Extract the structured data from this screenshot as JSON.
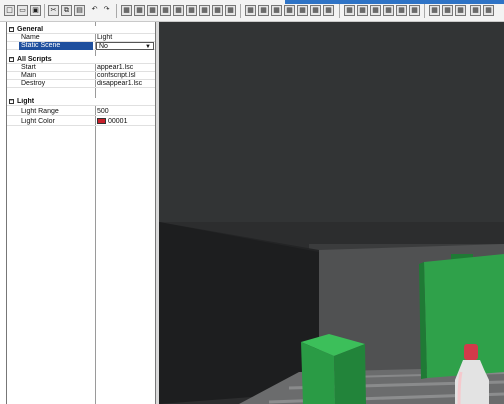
{
  "toolbar": {
    "icons": [
      "new-file-icon",
      "open-folder-icon",
      "save-icon",
      "cut-icon",
      "copy-icon",
      "paste-icon",
      "undo-icon",
      "redo-icon"
    ],
    "tool_icons": [
      "grid-tool-icon",
      "grid-tool-icon",
      "grid-tool-icon",
      "grid-tool-icon",
      "grid-tool-icon",
      "grid-tool-icon",
      "grid-tool-icon",
      "grid-tool-icon",
      "grid-tool-icon",
      "grid-tool-icon",
      "grid-tool-icon",
      "grid-tool-icon",
      "grid-tool-icon",
      "grid-tool-icon",
      "grid-tool-icon",
      "grid-tool-icon",
      "grid-tool-icon",
      "grid-tool-icon",
      "grid-tool-icon",
      "grid-tool-icon",
      "grid-tool-icon",
      "grid-tool-icon",
      "grid-tool-icon",
      "grid-tool-icon",
      "grid-tool-icon"
    ],
    "accent_color": "#2e73c6"
  },
  "properties": {
    "general": {
      "title": "General",
      "rows": [
        {
          "key": "Name",
          "value": "Light"
        },
        {
          "key": "Static Scene",
          "value": "No"
        }
      ]
    },
    "scripts": {
      "title": "All Scripts",
      "rows": [
        {
          "key": "Start",
          "value": "appear1.lsc"
        },
        {
          "key": "Main",
          "value": "confscript.lsl"
        },
        {
          "key": "Destroy",
          "value": "disappear1.lsc"
        }
      ]
    },
    "light": {
      "title": "Light",
      "rows": [
        {
          "key": "Light Range",
          "value": "500"
        },
        {
          "key": "Light Color",
          "value": "00001"
        }
      ],
      "color_swatch": "#c8202a"
    }
  },
  "viewport": {
    "background": "#2c2d2e",
    "box_color": "#2fa14a",
    "bottle_color": "#d8d8d8",
    "cap_color": "#d23a4a"
  }
}
